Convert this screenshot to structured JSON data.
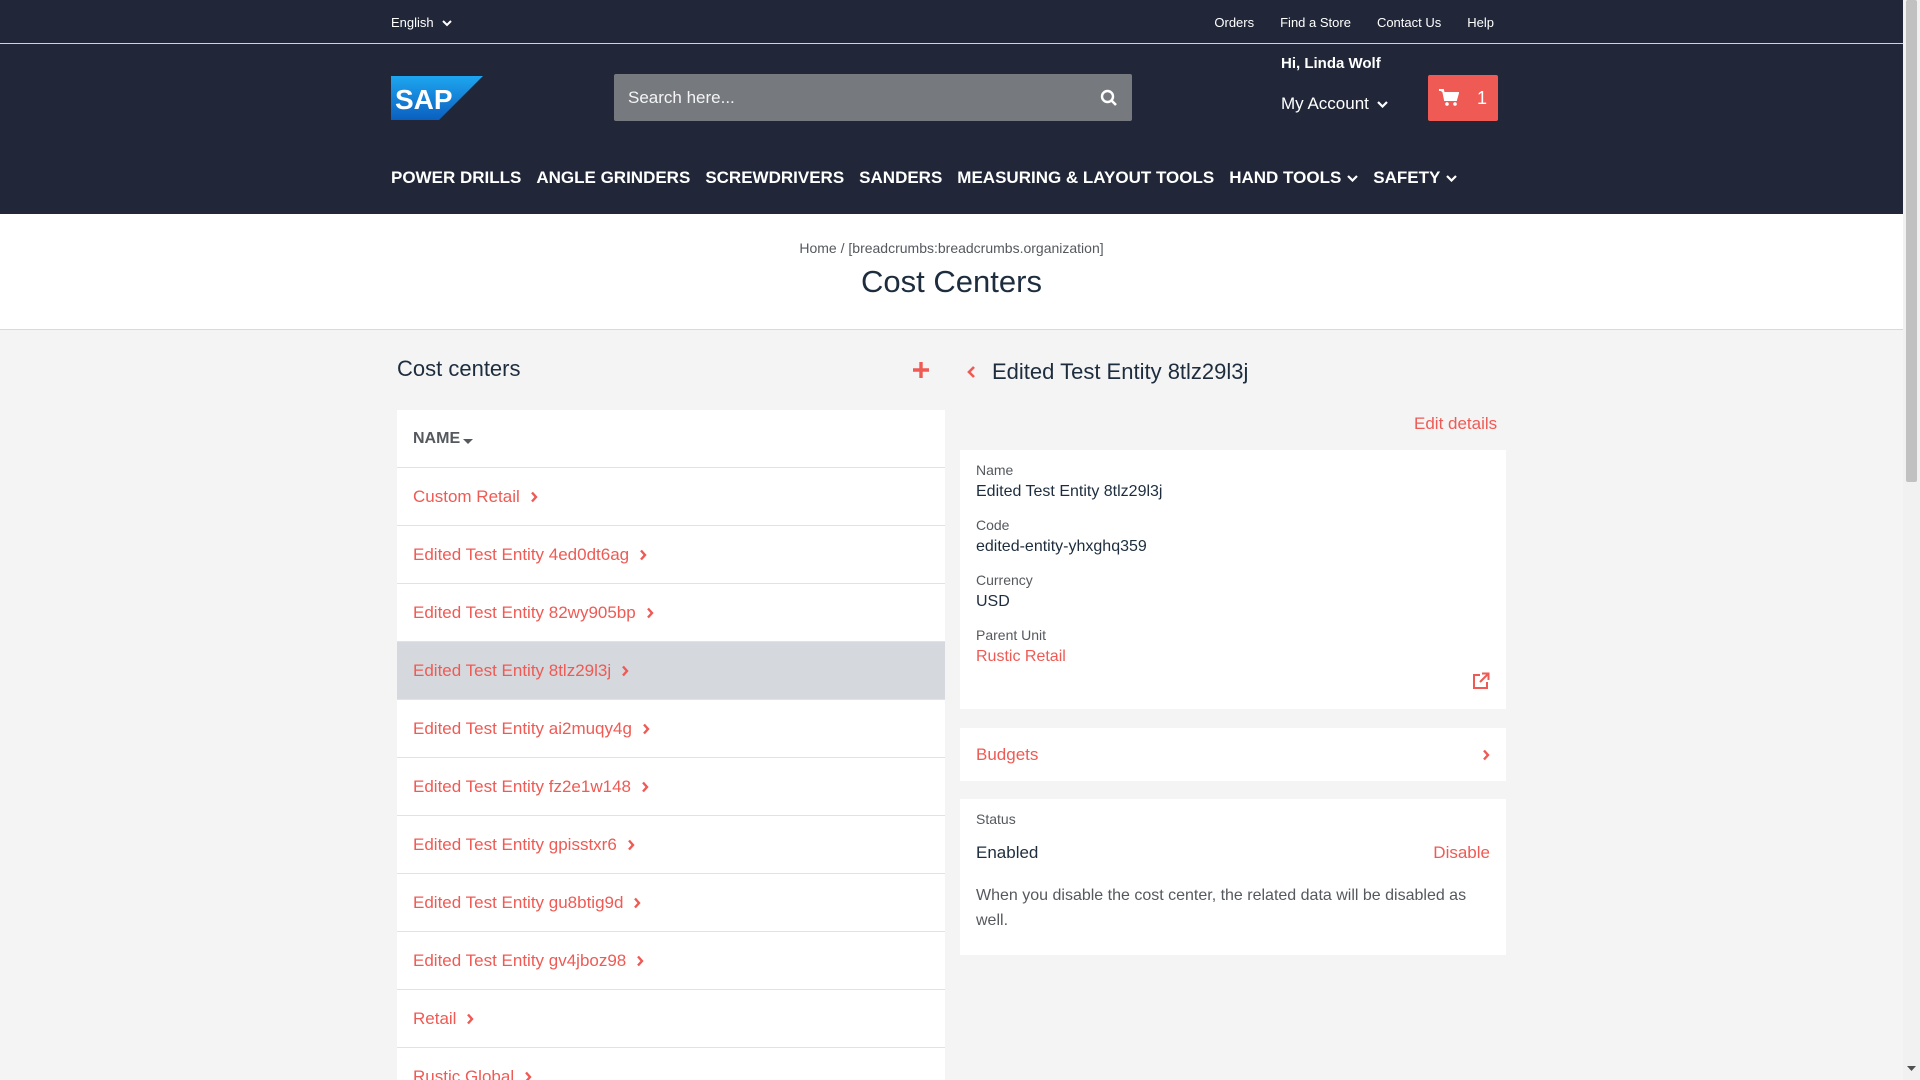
{
  "topbar": {
    "language": "English",
    "links": [
      "Orders",
      "Find a Store",
      "Contact Us",
      "Help"
    ]
  },
  "header": {
    "logo_text": "SAP",
    "search_placeholder": "Search here...",
    "greeting": "Hi, Linda Wolf",
    "account_label": "My Account",
    "cart_count": "1"
  },
  "nav": [
    {
      "label": "POWER DRILLS",
      "dropdown": false
    },
    {
      "label": "ANGLE GRINDERS",
      "dropdown": false
    },
    {
      "label": "SCREWDRIVERS",
      "dropdown": false
    },
    {
      "label": "SANDERS",
      "dropdown": false
    },
    {
      "label": "MEASURING & LAYOUT TOOLS",
      "dropdown": false
    },
    {
      "label": "HAND TOOLS",
      "dropdown": true
    },
    {
      "label": "SAFETY",
      "dropdown": true
    }
  ],
  "breadcrumb": {
    "home": "Home",
    "separator": "/",
    "current": "[breadcrumbs:breadcrumbs.organization]"
  },
  "page_title": "Cost Centers",
  "list": {
    "heading": "Cost centers",
    "column_header": "NAME",
    "rows": [
      "Custom Retail",
      "Edited Test Entity 4ed0dt6ag",
      "Edited Test Entity 82wy905bp",
      "Edited Test Entity 8tlz29l3j",
      "Edited Test Entity ai2muqy4g",
      "Edited Test Entity fz2e1w148",
      "Edited Test Entity gpisstxr6",
      "Edited Test Entity gu8btig9d",
      "Edited Test Entity gv4jboz98",
      "Retail",
      "Rustic Global"
    ],
    "active_row": "Edited Test Entity 8tlz29l3j"
  },
  "detail": {
    "title": "Edited Test Entity 8tlz29l3j",
    "edit_label": "Edit details",
    "fields": {
      "name_label": "Name",
      "name_value": "Edited Test Entity 8tlz29l3j",
      "code_label": "Code",
      "code_value": "edited-entity-yhxghq359",
      "currency_label": "Currency",
      "currency_value": "USD",
      "parent_label": "Parent Unit",
      "parent_value": "Rustic Retail"
    },
    "budgets_label": "Budgets",
    "status": {
      "label": "Status",
      "value": "Enabled",
      "action": "Disable",
      "note": "When you disable the cost center, the related data will be disabled as well."
    }
  },
  "colors": {
    "header_bg": "#212738",
    "accent": "#ef5a54",
    "logo_blue": "#1e88e5"
  }
}
